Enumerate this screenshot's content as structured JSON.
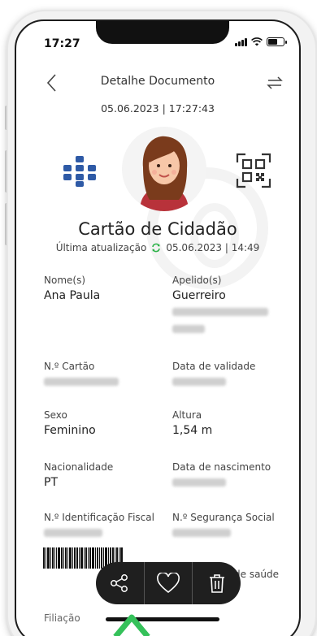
{
  "status_bar": {
    "time": "17:27"
  },
  "header": {
    "title": "Detalhe Documento",
    "datetime": "05.06.2023 | 17:27:43"
  },
  "document": {
    "title": "Cartão de Cidadão",
    "last_update_label": "Última atualização",
    "last_update_value": "05.06.2023 | 14:49"
  },
  "fields": {
    "name_label": "Nome(s)",
    "name_value": "Ana Paula",
    "surname_label": "Apelido(s)",
    "surname_value": "Guerreiro",
    "card_number_label": "N.º Cartão",
    "expiry_label": "Data de validade",
    "sex_label": "Sexo",
    "sex_value": "Feminino",
    "height_label": "Altura",
    "height_value": "1,54 m",
    "nationality_label": "Nacionalidade",
    "nationality_value": "PT",
    "birthdate_label": "Data de nascimento",
    "tax_id_label": "N.º Identificação Fiscal",
    "social_security_label": "N.º Segurança Social",
    "health_label_partial": "de saúde",
    "filiation_label": "Filiação"
  },
  "icons": {
    "back": "chevron-left-icon",
    "switch": "swap-arrows-icon",
    "logo": "portugal-cross-logo",
    "qr": "qr-code-icon",
    "sync": "sync-icon",
    "share": "share-icon",
    "favorite": "heart-icon",
    "delete": "trash-icon"
  },
  "colors": {
    "logo_blue": "#2e5aa6",
    "sync_green": "#2eb34a",
    "fab_bg": "#1f1f1f",
    "hint_green": "#35c15a"
  }
}
